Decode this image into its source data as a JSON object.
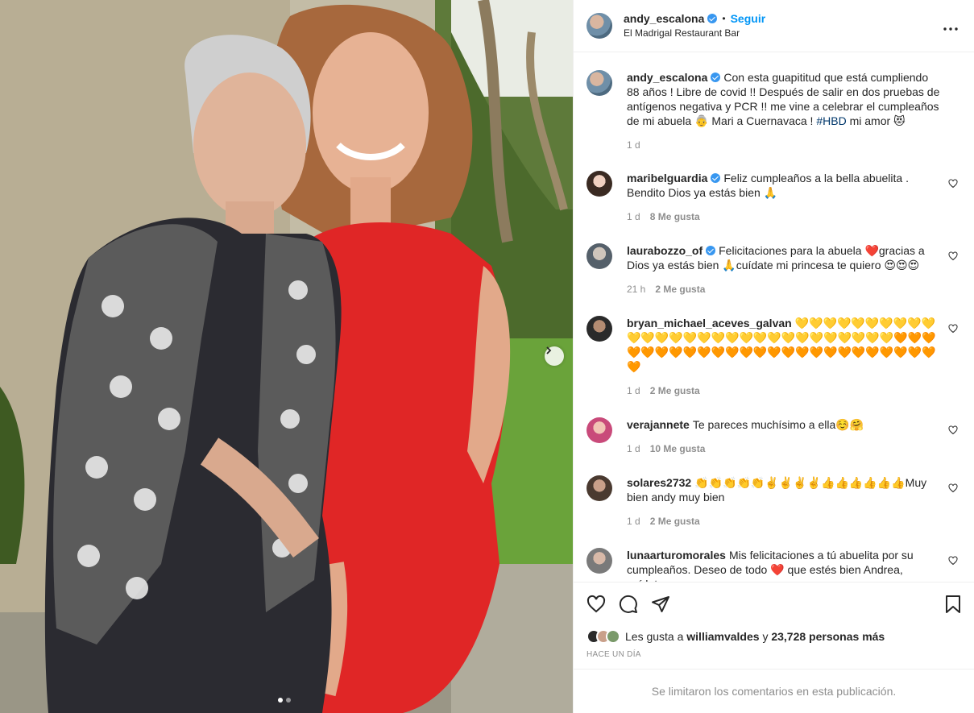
{
  "header": {
    "username": "andy_escalona",
    "separator": "•",
    "follow_label": "Seguir",
    "location": "El Madrigal Restaurant Bar",
    "more_icon": "more-horizontal-icon"
  },
  "caption": {
    "username": "andy_escalona",
    "text": "Con esta guapititud que está cumpliendo 88 años ! Libre de covid !! Después de salir en dos pruebas de antígenos negativa y PCR !! me vine a celebrar el cumpleaños de mi abuela 👵 Mari a Cuernavaca !",
    "hashtag": "#HBD",
    "text_after": "mi amor 😻",
    "time": "1 d"
  },
  "comments": [
    {
      "username": "maribelguardia",
      "verified": true,
      "text": "Feliz cumpleaños a la bella abuelita . Bendito Dios ya estás bien 🙏",
      "time": "1 d",
      "likes": "8 Me gusta"
    },
    {
      "username": "laurabozzo_of",
      "verified": true,
      "text": "Felicitaciones para la abuela ❤️gracias a Dios ya estás bien 🙏cuídate mi princesa te quiero 😍😍😍",
      "time": "21 h",
      "likes": "2 Me gusta"
    },
    {
      "username": "bryan_michael_aceves_galvan",
      "verified": false,
      "text": "💛💛💛💛💛💛💛💛💛💛💛💛💛💛💛💛💛💛💛💛💛💛💛💛💛💛💛💛💛🧡🧡🧡🧡🧡🧡🧡🧡🧡🧡🧡🧡🧡🧡🧡🧡🧡🧡🧡🧡🧡🧡🧡🧡🧡🧡",
      "time": "1 d",
      "likes": "2 Me gusta"
    },
    {
      "username": "verajannete",
      "verified": false,
      "text": "Te pareces muchísimo a ella☺️🤗",
      "time": "1 d",
      "likes": "10 Me gusta"
    },
    {
      "username": "solares2732",
      "verified": false,
      "text": "👏👏👏👏👏✌️✌️✌️✌️👍👍👍👍👍👍Muy bien andy muy bien",
      "time": "1 d",
      "likes": "2 Me gusta"
    },
    {
      "username": "lunaarturomorales",
      "verified": false,
      "text": "Mis felicitaciones a tú abuelita por su cumpleaños. Deseo de todo ❤️ que estés bien Andrea, cuídate",
      "time": "",
      "likes": ""
    }
  ],
  "actions": {
    "like_icon": "heart-icon",
    "comment_icon": "comment-icon",
    "share_icon": "send-icon",
    "save_icon": "bookmark-icon"
  },
  "likes": {
    "prefix": "Les gusta a",
    "user": "williamvaldes",
    "middle": "y",
    "count": "23,728 personas más"
  },
  "timeago": "HACE UN DÍA",
  "comments_limited": "Se limitaron los comentarios en esta publicación.",
  "colors": {
    "accent": "#0095f6",
    "verified": "#3897f0",
    "secondary_text": "#8e8e8e",
    "hashtag": "#00376b",
    "dress": "#e02626"
  },
  "carousel": {
    "current": 1,
    "total": 2
  }
}
